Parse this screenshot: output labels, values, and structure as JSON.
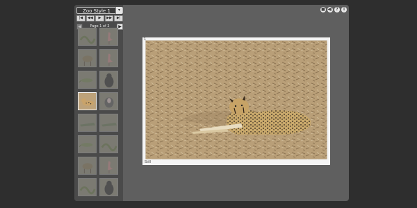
{
  "window": {
    "style_selector": {
      "selected": "Zoo Style 1"
    },
    "transport": [
      {
        "name": "first-button",
        "glyph": "|◀"
      },
      {
        "name": "prev-button",
        "glyph": "◀◀"
      },
      {
        "name": "play-button",
        "glyph": "▶"
      },
      {
        "name": "next-button",
        "glyph": "▶▶"
      },
      {
        "name": "last-button",
        "glyph": "▶|"
      }
    ],
    "pager": {
      "text": "Page 1 of 2",
      "prev_glyph": "◀",
      "next_glyph": "▶"
    },
    "top_icons": [
      {
        "name": "stop-icon",
        "glyph": "■"
      },
      {
        "name": "sound-icon",
        "glyph": "◀)"
      },
      {
        "name": "help-icon",
        "glyph": "?"
      },
      {
        "name": "info-icon",
        "glyph": "i"
      }
    ],
    "thumbnails": [
      {
        "subject": "snake"
      },
      {
        "subject": "flamingo"
      },
      {
        "subject": "deer"
      },
      {
        "subject": "flamingo"
      },
      {
        "subject": "lizard"
      },
      {
        "subject": "gorilla"
      },
      {
        "subject": "cheetah",
        "active": true
      },
      {
        "subject": "baboon"
      },
      {
        "subject": "crocodile"
      },
      {
        "subject": "crocodile"
      },
      {
        "subject": "lizard"
      },
      {
        "subject": "snake"
      },
      {
        "subject": "deer"
      },
      {
        "subject": "flamingo"
      },
      {
        "subject": "snake"
      },
      {
        "subject": "gorilla"
      }
    ],
    "photo": {
      "number": "1",
      "caption": "Still",
      "subject": "cheetah"
    },
    "colors": {
      "background": "#2e2e2e",
      "panel": "#5f5f5f",
      "sidebar": "#4a4a4a",
      "frame": "#f4f4f4"
    }
  }
}
